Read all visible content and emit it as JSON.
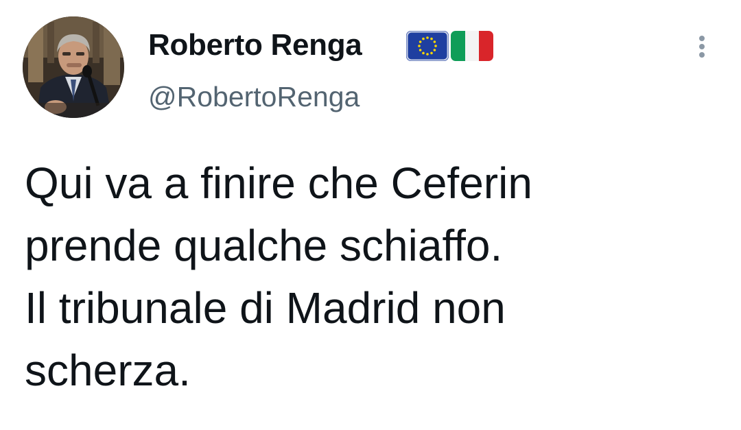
{
  "author": {
    "display_name": "Roberto Renga",
    "handle": "@RobertoRenga",
    "flags": [
      "eu-flag-icon",
      "italy-flag-icon"
    ]
  },
  "tweet": {
    "lines": [
      "Qui va a finire che Ceferin",
      "prende qualche schiaffo.",
      "Il tribunale di Madrid non",
      "scherza."
    ]
  },
  "colors": {
    "text_primary": "#0f1419",
    "text_secondary": "#536471",
    "menu_dots": "#8b98a5",
    "eu_blue": "#1f3fa0",
    "eu_star": "#ffd800",
    "italy_green": "#0f9d58",
    "italy_red": "#d9252a"
  },
  "icons": {
    "menu": "more-vertical-icon"
  }
}
